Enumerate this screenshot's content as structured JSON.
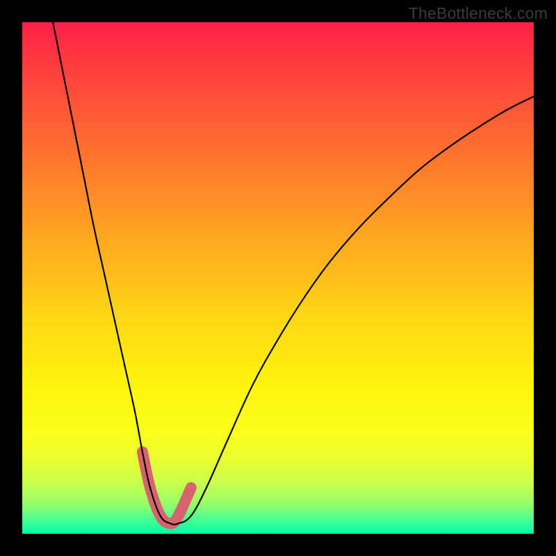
{
  "watermark": "TheBottleneck.com",
  "chart_data": {
    "type": "line",
    "title": "",
    "xlabel": "",
    "ylabel": "",
    "xlim": [
      0,
      100
    ],
    "ylim": [
      0,
      100
    ],
    "grid": false,
    "series": [
      {
        "name": "bottleneck-curve",
        "x": [
          6,
          8,
          10,
          12,
          14,
          16,
          18,
          20,
          22,
          23.5,
          25,
          27,
          29,
          30.5,
          33,
          36,
          40,
          45,
          50,
          55,
          60,
          66,
          72,
          78,
          84,
          90,
          95,
          100
        ],
        "values": [
          100,
          90,
          80,
          70,
          60,
          51,
          42,
          33,
          24,
          16,
          9,
          3.5,
          2,
          2,
          3.5,
          9,
          18,
          29,
          38,
          46,
          53,
          60,
          66,
          71.5,
          76,
          80,
          83,
          85.5
        ]
      },
      {
        "name": "highlight-dip",
        "x": [
          23.5,
          25,
          27,
          29,
          30.5,
          33
        ],
        "values": [
          16,
          9,
          3.5,
          2,
          3.5,
          9
        ]
      }
    ],
    "colors": {
      "curve": "#000000",
      "highlight": "#d6636f",
      "background_top": "#ff1f47",
      "background_bottom": "#00ffa8",
      "frame": "#000000"
    }
  }
}
